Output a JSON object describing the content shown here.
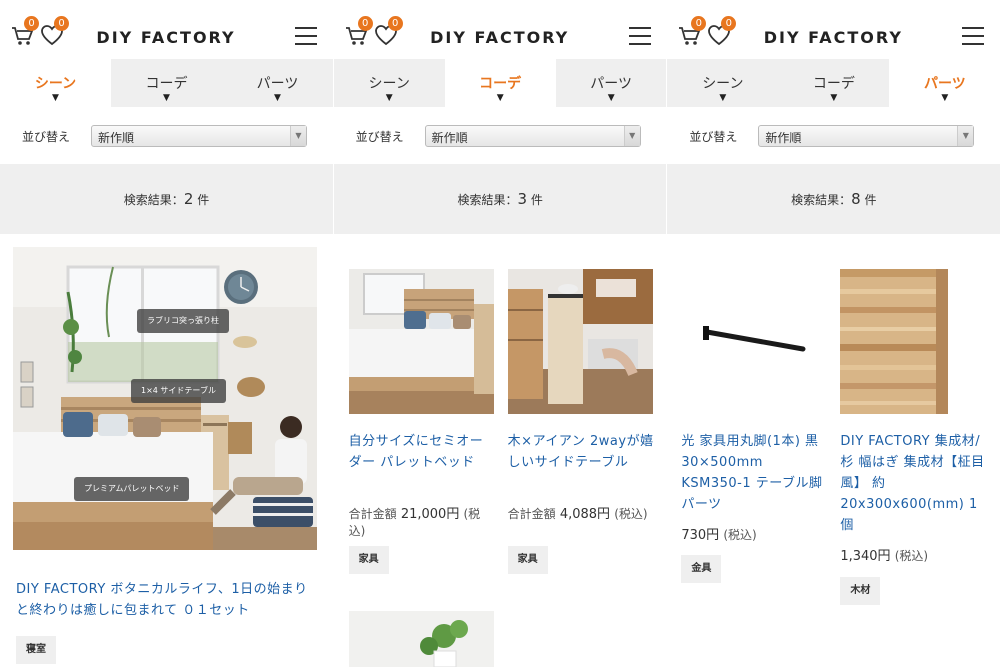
{
  "panels": [
    {
      "header": {
        "logo": "DIY FACTORY",
        "cart_count": "0",
        "fav_count": "0"
      },
      "tabs": [
        {
          "label": "シーン",
          "arrow": "▼",
          "active": true
        },
        {
          "label": "コーデ",
          "arrow": "▼",
          "active": false
        },
        {
          "label": "パーツ",
          "arrow": "▼",
          "active": false
        }
      ],
      "sort": {
        "label": "並び替え",
        "value": "新作順"
      },
      "results": {
        "prefix": "検索結果：",
        "count": "2",
        "suffix": "件"
      },
      "hotspots": [
        "ラブリコ突っ張り柱",
        "1×4 サイドテーブル",
        "プレミアムパレットベッド"
      ],
      "items": [
        {
          "title": "DIY FACTORY ボタニカルライフ、1日の始まりと終わりは癒しに包まれて ０１セット",
          "tag": "寝室"
        }
      ]
    },
    {
      "header": {
        "logo": "DIY FACTORY",
        "cart_count": "0",
        "fav_count": "0"
      },
      "tabs": [
        {
          "label": "シーン",
          "arrow": "▼",
          "active": false
        },
        {
          "label": "コーデ",
          "arrow": "▼",
          "active": true
        },
        {
          "label": "パーツ",
          "arrow": "▼",
          "active": false
        }
      ],
      "sort": {
        "label": "並び替え",
        "value": "新作順"
      },
      "results": {
        "prefix": "検索結果：",
        "count": "3",
        "suffix": "件"
      },
      "items": [
        {
          "title": "自分サイズにセミオーダー パレットベッド",
          "price_label": "合計金額",
          "price": "21,000円",
          "tax": "(税込)",
          "tag": "家具"
        },
        {
          "title": "木×アイアン 2wayが嬉しいサイドテーブル",
          "price_label": "合計金額",
          "price": "4,088円",
          "tax": "(税込)",
          "tag": "家具"
        }
      ]
    },
    {
      "header": {
        "logo": "DIY FACTORY",
        "cart_count": "0",
        "fav_count": "0"
      },
      "tabs": [
        {
          "label": "シーン",
          "arrow": "▼",
          "active": false
        },
        {
          "label": "コーデ",
          "arrow": "▼",
          "active": false
        },
        {
          "label": "パーツ",
          "arrow": "▼",
          "active": true
        }
      ],
      "sort": {
        "label": "並び替え",
        "value": "新作順"
      },
      "results": {
        "prefix": "検索結果：",
        "count": "8",
        "suffix": "件"
      },
      "items": [
        {
          "title": "光 家具用丸脚(1本) 黒 30×500mm KSM350-1 テーブル脚　パーツ",
          "price": "730円",
          "tax": "(税込)",
          "tag": "金具"
        },
        {
          "title": "DIY FACTORY 集成材/杉 幅はぎ 集成材【柾目風】 約20x300x600(mm) 1個",
          "price": "1,340円",
          "tax": "(税込)",
          "tag": "木材"
        }
      ]
    }
  ],
  "colors": {
    "accent": "#e8761f",
    "link": "#1d5fa6",
    "bar": "#efefef"
  },
  "icons": [
    "cart-icon",
    "heart-icon",
    "hamburger-menu-icon",
    "select-chevron-icon"
  ]
}
